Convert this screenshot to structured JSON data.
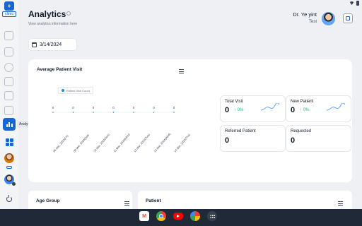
{
  "header": {
    "title": "Analytics",
    "subtitle": "View analytics information here",
    "doctor_name": "Dr. Ye yint",
    "doctor_role": "Test"
  },
  "sidebar": {
    "logo_text": "clinic",
    "active_tooltip": "Analytics",
    "items": [
      {
        "icon": "people-icon"
      },
      {
        "icon": "briefcase-icon"
      },
      {
        "icon": "stethoscope-icon"
      },
      {
        "icon": "document-icon"
      },
      {
        "icon": "file-icon"
      },
      {
        "icon": "clipboard-icon"
      },
      {
        "icon": "analytics-icon",
        "label": "Analytics",
        "active": true
      },
      {
        "icon": "grid-icon"
      }
    ]
  },
  "filter": {
    "date": "3/14/2024"
  },
  "chart_card": {
    "title": "Average Patient Visit"
  },
  "chart_data": {
    "type": "line",
    "categories": [
      "08 Mar, 2024(Fri)",
      "09 Mar, 2024(Sat)",
      "10 Mar, 2024(Sun)",
      "11 Mar, 2024(Mon)",
      "12 Mar, 2024(Tue)",
      "13 Mar, 2024(Wed)",
      "14 Mar, 2024(Thu)"
    ],
    "series": [
      {
        "name": "Patient Visit Count",
        "values": [
          0,
          0,
          0,
          0,
          0,
          0,
          0
        ]
      }
    ],
    "value_labels": [
      "0",
      "0",
      "0",
      "0",
      "0",
      "0",
      "0"
    ],
    "title": "Average Patient Visit",
    "xlabel": "",
    "ylabel": "",
    "legend": "top-left",
    "grid": false,
    "colors": {
      "series": "#1f8fd6"
    }
  },
  "stats": [
    {
      "label": "Total Visit",
      "value": "0",
      "change": "0%",
      "has_trend": true
    },
    {
      "label": "New Patient",
      "value": "0",
      "change": "0%",
      "has_trend": true
    },
    {
      "label": "Referred Patient",
      "value": "0"
    },
    {
      "label": "Requested",
      "value": "0"
    }
  ],
  "bottom_cards": [
    {
      "title": "Age Group"
    },
    {
      "title": "Patient"
    }
  ],
  "taskbar": {
    "apps": [
      "gmail-icon",
      "chrome-icon",
      "youtube-icon",
      "photos-icon",
      "app-drawer-icon"
    ]
  },
  "colors": {
    "accent": "#1667d3",
    "positive": "#10b981",
    "background": "#eef0f3"
  }
}
